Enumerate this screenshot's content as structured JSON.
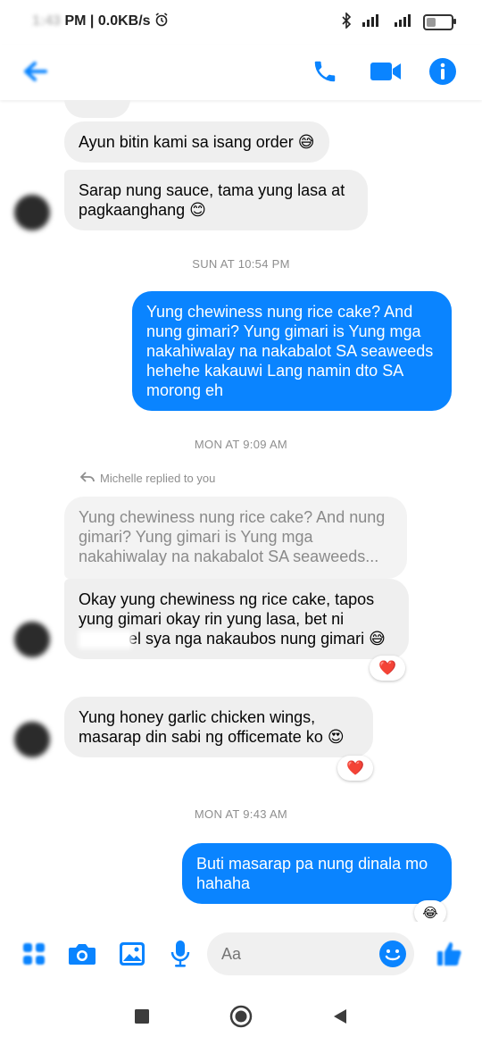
{
  "status_bar": {
    "time_partial": "1:43",
    "time_suffix": "PM | 0.0KB/s",
    "alarm_icon": "alarm-icon",
    "bluetooth_icon": "bluetooth-icon",
    "signal_icon": "signal-icon",
    "wifi_icon": "wifi-icon",
    "battery_text": "40",
    "battery_level": 0.4
  },
  "header": {
    "back_icon": "back-arrow-icon",
    "call_icon": "phone-icon",
    "video_icon": "video-camera-icon",
    "info_icon": "info-icon",
    "accent": "#0a84ff"
  },
  "messages": {
    "m1": "Ayun bitin kami sa isang order 😅",
    "m2": "Sarap nung sauce, tama yung lasa at pagkaanghang 😊",
    "ts1": "SUN AT 10:54 PM",
    "m3": "Yung chewiness nung rice cake? And nung gimari? Yung gimari is Yung mga nakahiwalay na nakabalot SA seaweeds hehehe kakauwi Lang namin dto SA morong eh",
    "ts2": "MON AT 9:09 AM",
    "replied_label": "Michelle replied to you",
    "quoted": "Yung chewiness nung rice cake? And nung gimari? Yung gimari is Yung mga nakahiwalay na nakabalot SA seaweeds...",
    "m4_line1": "Okay yung chewiness ng rice cake, tapos yung gimari okay rin yung lasa, bet ni",
    "m4_line2": "el sya nga nakaubos nung gimari 😅",
    "reaction1": "❤️",
    "m5": "Yung honey garlic chicken wings, masarap din sabi ng officemate ko 😍",
    "reaction2": "❤️",
    "ts3": "MON AT 9:43 AM",
    "m6": "Buti masarap pa nung dinala mo hahaha",
    "reaction3": "😂"
  },
  "composer": {
    "apps_icon": "apps-grid-icon",
    "camera_icon": "camera-icon",
    "gallery_icon": "image-icon",
    "mic_icon": "microphone-icon",
    "placeholder": "Aa",
    "emoji_icon": "smiley-icon",
    "like_icon": "thumbs-up-icon"
  },
  "nav": {
    "recents_icon": "square-icon",
    "home_icon": "home-circle-icon",
    "back_icon": "triangle-back-icon"
  }
}
